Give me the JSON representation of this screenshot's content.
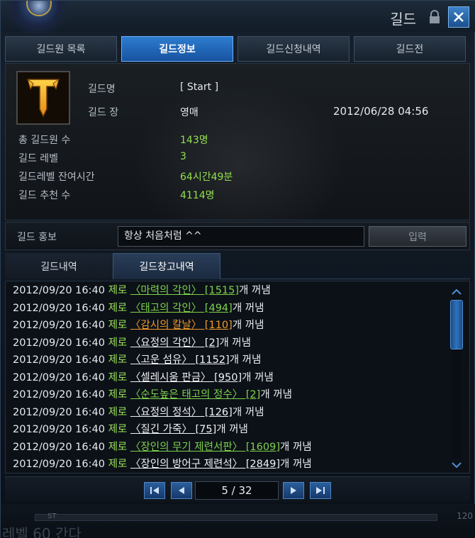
{
  "window": {
    "title": "길드"
  },
  "tabs": [
    {
      "label": "길드원 목록",
      "active": false
    },
    {
      "label": "길드정보",
      "active": true
    },
    {
      "label": "길드신청내역",
      "active": false
    },
    {
      "label": "길드전",
      "active": false
    }
  ],
  "info": {
    "guild_name_label": "길드명",
    "guild_name": "[ Start ]",
    "master_label": "길드 장",
    "master": "영매",
    "created": "2012/06/28 04:56",
    "members_label": "총 길드원 수",
    "members": "143명",
    "level_label": "길드 레벨",
    "level": "3",
    "time_label": "길드레벨 잔여시간",
    "time_left": "64시간49분",
    "recommend_label": "길드 추천 수",
    "recommend": "4114명"
  },
  "promo": {
    "label": "길드 홍보",
    "value": "항상 처음처럼 ^^",
    "button": "입력"
  },
  "subtabs": [
    {
      "label": "길드내역",
      "active": false
    },
    {
      "label": "길드창고내역",
      "active": true
    }
  ],
  "log": [
    {
      "date": "2012/09/20 16:40",
      "actor": "제로",
      "item": "〈마력의 각인〉 [1515]",
      "color": "green",
      "suffix": "개 꺼냄"
    },
    {
      "date": "2012/09/20 16:40",
      "actor": "제로",
      "item": "〈태고의 각인〉 [494]",
      "color": "green",
      "suffix": "개 꺼냄"
    },
    {
      "date": "2012/09/20 16:40",
      "actor": "제로",
      "item": "〈감시의 칼날〉 [110]",
      "color": "orange",
      "suffix": "개 꺼냄"
    },
    {
      "date": "2012/09/20 16:40",
      "actor": "제로",
      "item": "〈요정의 각인〉 [2]",
      "color": "white",
      "suffix": "개 꺼냄"
    },
    {
      "date": "2012/09/20 16:40",
      "actor": "제로",
      "item": "〈고운 섬유〉 [1152]",
      "color": "white",
      "suffix": "개 꺼냄"
    },
    {
      "date": "2012/09/20 16:40",
      "actor": "제로",
      "item": "〈셀레시움 판금〉 [950]",
      "color": "white",
      "suffix": "개 꺼냄"
    },
    {
      "date": "2012/09/20 16:40",
      "actor": "제로",
      "item": "〈순도높은 태고의 정수〉 [2]",
      "color": "green",
      "suffix": "개 꺼냄"
    },
    {
      "date": "2012/09/20 16:40",
      "actor": "제로",
      "item": "〈요정의 정석〉 [126]",
      "color": "white",
      "suffix": "개 꺼냄"
    },
    {
      "date": "2012/09/20 16:40",
      "actor": "제로",
      "item": "〈질긴 가죽〉 [75]",
      "color": "white",
      "suffix": "개 꺼냄"
    },
    {
      "date": "2012/09/20 16:40",
      "actor": "제로",
      "item": "〈장인의 무기 제련서판〉 [1609]",
      "color": "green",
      "suffix": "개 꺼냄"
    },
    {
      "date": "2012/09/20 16:40",
      "actor": "제로",
      "item": "〈장인의 방어구 제련석〉 [2849]",
      "color": "white",
      "suffix": "개 꺼냄"
    }
  ],
  "pager": {
    "display": "5 / 32"
  },
  "background": {
    "bar_label": "ST",
    "number": "120",
    "faded_text": "레벨 60 간다"
  },
  "icons": {
    "lock": "lock-icon",
    "close": "close-icon",
    "emblem": "guild-cross-emblem-icon"
  },
  "colors": {
    "accent": "#2d7ccf",
    "green": "#93e04f",
    "orange": "#f09a28"
  }
}
